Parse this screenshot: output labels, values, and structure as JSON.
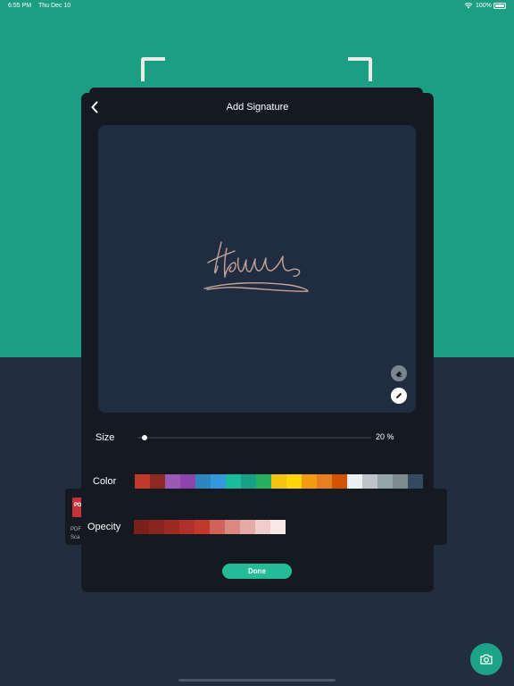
{
  "status_bar": {
    "time": "6:55 PM",
    "date": "Thu Dec 10",
    "battery": "100%"
  },
  "document": {
    "thumb_label": "PDF",
    "line1": "PDF",
    "line2": "Sca"
  },
  "modal": {
    "title": "Add Signature",
    "signature_color": "#c4a59a",
    "size": {
      "label": "Size",
      "value_text": "20 %",
      "fraction": 0.02
    },
    "color": {
      "label": "Color",
      "swatches": [
        "#c0392b",
        "#8e2a24",
        "#9b59b6",
        "#8e44ad",
        "#2e86c1",
        "#3498db",
        "#1abc9c",
        "#16a085",
        "#27ae60",
        "#f1c40f",
        "#ffd60a",
        "#f39c12",
        "#e67e22",
        "#d35400",
        "#ecf0f1",
        "#bdc3c7",
        "#95a5a6",
        "#7f8c8d",
        "#34495e"
      ]
    },
    "opacity": {
      "label": "Opecity",
      "swatches": [
        "#7a1f1a",
        "#8a2520",
        "#9c2a24",
        "#b0302a",
        "#c0392b",
        "#d0625a",
        "#dc8883",
        "#e6aaa6",
        "#f0cccb",
        "#f8e8e8"
      ]
    },
    "done_label": "Done"
  },
  "colors": {
    "background_top": "#1c9e82",
    "background_bottom": "#222d3e",
    "modal": "#141922",
    "canvas": "#202c40",
    "accent": "#23bb98"
  }
}
